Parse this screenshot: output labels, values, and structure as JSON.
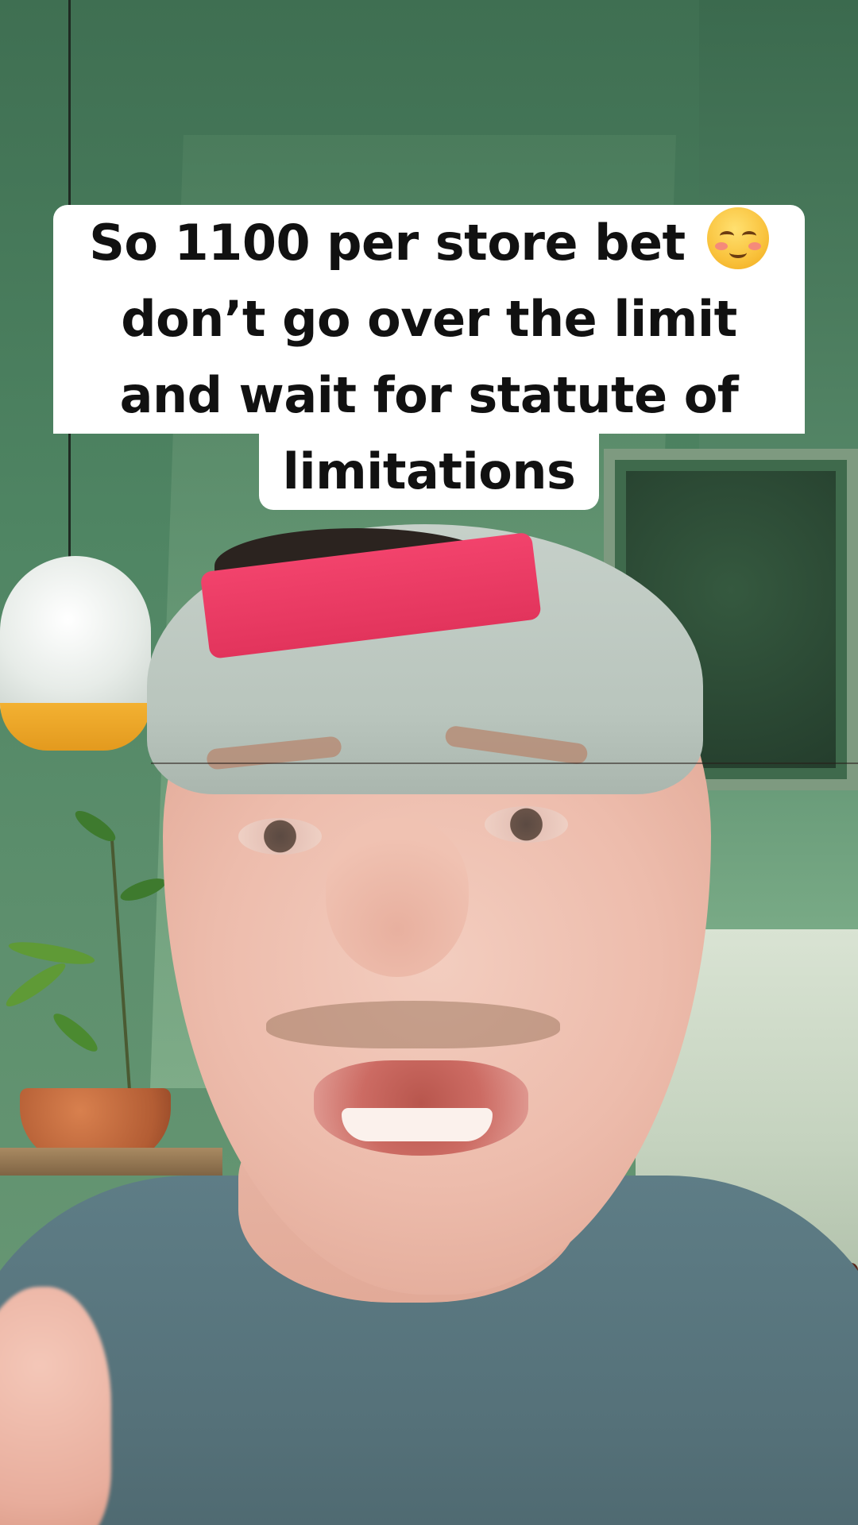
{
  "caption": {
    "lines": [
      "So 1100 per store bet",
      "don’t go over the limit",
      "and wait for statute of",
      "limitations"
    ],
    "emoji": "smiling-face-icon"
  },
  "colors": {
    "caption_bg": "#ffffff",
    "caption_text": "#111111",
    "wall_green": "#4f8563",
    "cap_band_pink": "#e2345c",
    "shirt": "#557179"
  }
}
